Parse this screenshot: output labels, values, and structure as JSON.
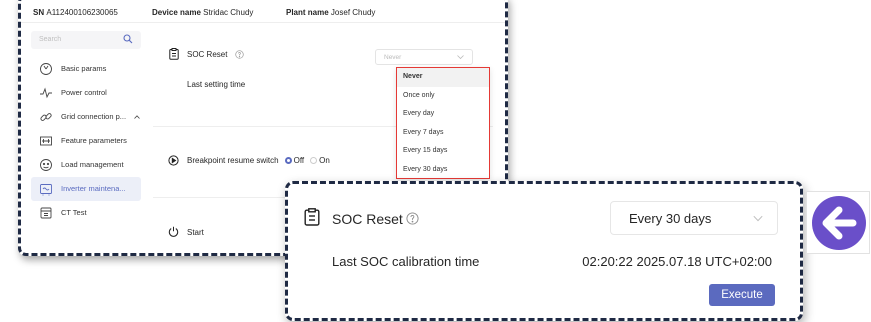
{
  "header": {
    "sn_label": "SN",
    "sn_value": "A112400106230065",
    "device_label": "Device name",
    "device_value": "Stridac Chudy",
    "plant_label": "Plant name",
    "plant_value": "Josef Chudy"
  },
  "sidebar": {
    "search_placeholder": "Search",
    "items": [
      {
        "label": "Basic params",
        "icon": "gauge-icon"
      },
      {
        "label": "Power control",
        "icon": "waveform-icon"
      },
      {
        "label": "Grid connection p...",
        "icon": "link-icon"
      },
      {
        "label": "Feature parameters",
        "icon": "parameters-icon"
      },
      {
        "label": "Load management",
        "icon": "load-icon"
      },
      {
        "label": "Inverter maintena...",
        "icon": "inverter-icon"
      },
      {
        "label": "CT Test",
        "icon": "ct-icon"
      }
    ]
  },
  "main": {
    "soc_reset_label": "SOC Reset",
    "soc_reset_value": "Never",
    "last_setting_label": "Last setting time",
    "breakpoint_label": "Breakpoint resume switch",
    "radio_off": "Off",
    "radio_on": "On",
    "start_label": "Start",
    "dropdown_options": [
      "Never",
      "Once only",
      "Every day",
      "Every 7 days",
      "Every 15 days",
      "Every 30 days"
    ],
    "dropdown_selected": "Never"
  },
  "zoom": {
    "title": "SOC Reset",
    "select_value": "Every 30 days",
    "calibration_label": "Last SOC calibration time",
    "calibration_value": "02:20:22 2025.07.18 UTC+02:00",
    "execute_label": "Execute"
  },
  "colors": {
    "accent": "#5b6abf",
    "arrow": "#6a4fc9",
    "highlight_border": "#e53935",
    "frame": "#1f2a44"
  },
  "icons": {
    "arrow_badge": "arrow-left-icon"
  }
}
